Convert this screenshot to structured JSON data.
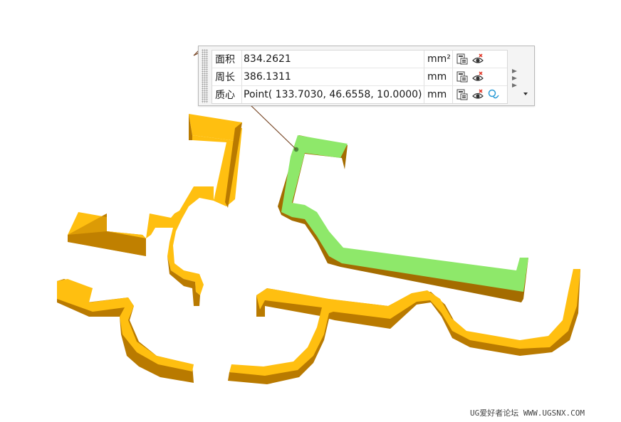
{
  "measurement": {
    "rows": [
      {
        "label": "面积",
        "value": "834.2621",
        "unit": "mm²"
      },
      {
        "label": "周长",
        "value": "386.1311",
        "unit": "mm"
      },
      {
        "label": "质心",
        "value": "Point( 133.7030, 46.6558, 10.0000)",
        "unit": "mm"
      }
    ],
    "icons": {
      "export": "export-to-sheet-icon",
      "visibility": "show-hide-eye-icon",
      "point": "point-constructor-icon"
    }
  },
  "colors": {
    "part_top": "#ffbf10",
    "part_side": "#b97a00",
    "selected_top": "#8ee86a",
    "selected_side": "#a46c00",
    "leader": "#7a4a2a"
  },
  "watermark": "UG爱好者论坛 WWW.UGSNX.COM"
}
